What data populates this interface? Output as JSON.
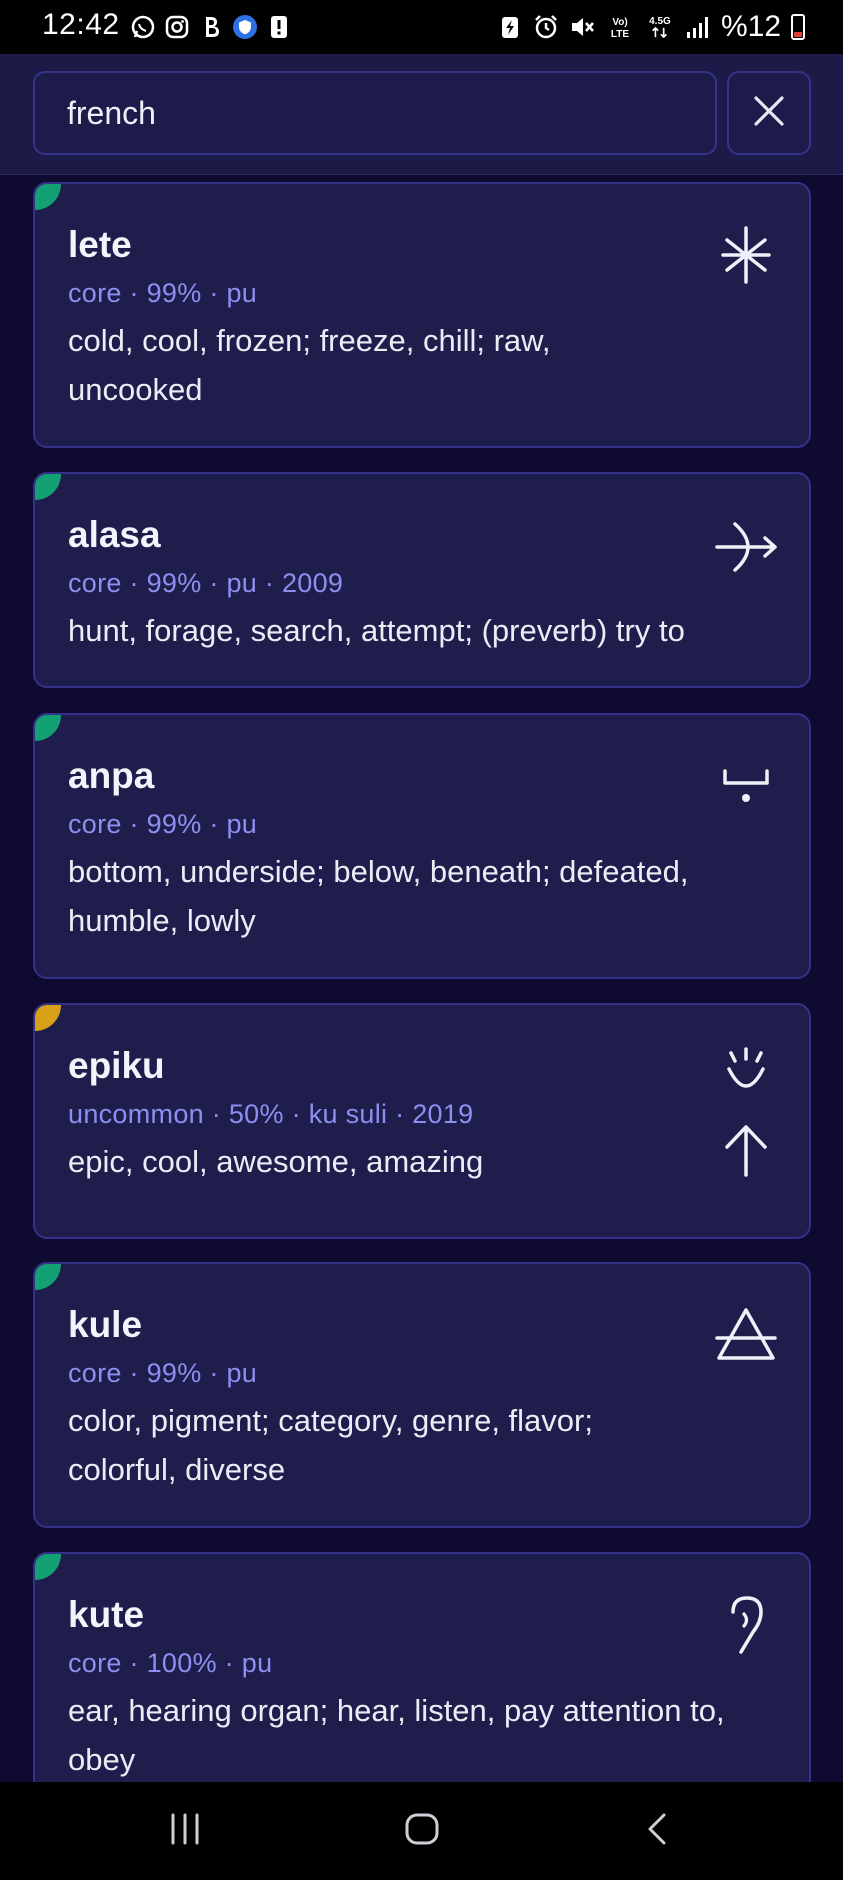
{
  "status_bar": {
    "time": "12:42",
    "left_icons": [
      "whatsapp-icon",
      "instagram-icon",
      "b-icon",
      "shield-icon",
      "alert-icon"
    ],
    "right_icons": [
      "battery-saver-icon",
      "alarm-icon",
      "mute-icon",
      "volte-icon",
      "data-arrows-icon",
      "signal-icon"
    ],
    "network_label": "4.5G",
    "battery_text": "%12"
  },
  "search": {
    "value": "french",
    "placeholder": ""
  },
  "close_icon": "close-icon",
  "entries": [
    {
      "word": "lete",
      "meta": "core · 99% · pu",
      "definition": "cold, cool, frozen; freeze, chill; raw, uncooked",
      "usage": "core",
      "glyph": "lete-glyph"
    },
    {
      "word": "alasa",
      "meta": "core · 99% · pu · 2009",
      "definition": "hunt, forage, search, attempt; (preverb) try to",
      "usage": "core",
      "glyph": "alasa-glyph"
    },
    {
      "word": "anpa",
      "meta": "core · 99% · pu",
      "definition": "bottom, underside; below, beneath; defeated, humble, lowly",
      "usage": "core",
      "glyph": "anpa-glyph"
    },
    {
      "word": "epiku",
      "meta": "uncommon · 50% · ku suli · 2019",
      "definition": "epic, cool, awesome, amazing",
      "usage": "uncommon",
      "glyph": "epiku-glyph"
    },
    {
      "word": "kule",
      "meta": "core · 99% · pu",
      "definition": "color, pigment; category, genre, flavor; colorful, diverse",
      "usage": "core",
      "glyph": "kule-glyph"
    },
    {
      "word": "kute",
      "meta": "core · 100% · pu",
      "definition": "ear, hearing organ; hear, listen, pay attention to, obey",
      "usage": "core",
      "glyph": "kute-glyph"
    }
  ],
  "colors": {
    "background": "#0f0b30",
    "card": "#1f1d4b",
    "meta_text": "#8c8ff0",
    "core_marker": "#13a173",
    "uncommon_marker": "#d8a016"
  },
  "nav": {
    "recents_icon": "recents-icon",
    "home_icon": "home-icon",
    "back_icon": "back-icon"
  }
}
